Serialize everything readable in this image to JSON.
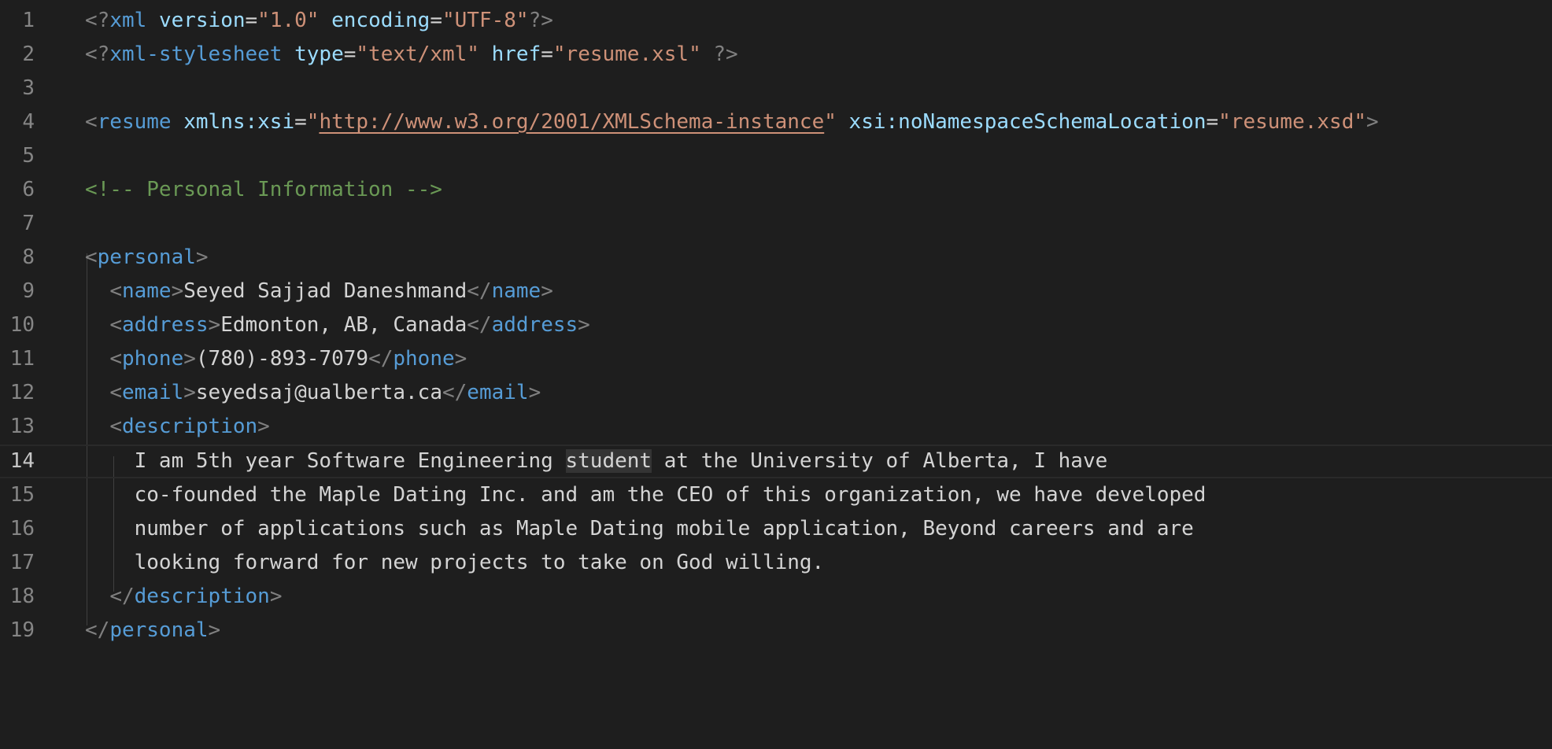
{
  "lines": [
    {
      "num": "1"
    },
    {
      "num": "2"
    },
    {
      "num": "3"
    },
    {
      "num": "4"
    },
    {
      "num": "5"
    },
    {
      "num": "6"
    },
    {
      "num": "7"
    },
    {
      "num": "8"
    },
    {
      "num": "9"
    },
    {
      "num": "10"
    },
    {
      "num": "11"
    },
    {
      "num": "12"
    },
    {
      "num": "13"
    },
    {
      "num": "14"
    },
    {
      "num": "15"
    },
    {
      "num": "16"
    },
    {
      "num": "17"
    },
    {
      "num": "18"
    },
    {
      "num": "19"
    }
  ],
  "xml_decl": {
    "open": "<?",
    "name": "xml",
    "version_attr": "version",
    "version_val": "\"1.0\"",
    "encoding_attr": "encoding",
    "encoding_val": "\"UTF-8\"",
    "close": "?>"
  },
  "stylesheet_pi": {
    "open": "<?",
    "name": "xml-stylesheet",
    "type_attr": "type",
    "type_val": "\"text/xml\"",
    "href_attr": "href",
    "href_val": "\"resume.xsl\"",
    "close": " ?>"
  },
  "resume_tag": {
    "name": "resume",
    "xmlns_attr": "xmlns:xsi",
    "quote": "\"",
    "xmlns_url": "http://www.w3.org/2001/XMLSchema-instance",
    "schema_attr": "xsi:noNamespaceSchemaLocation",
    "schema_val": "\"resume.xsd\""
  },
  "comment": "<!-- Personal Information -->",
  "personal": {
    "tag": "personal",
    "name_tag": "name",
    "name": "Seyed Sajjad Daneshmand",
    "address_tag": "address",
    "address": "Edmonton, AB, Canada",
    "phone_tag": "phone",
    "phone": "(780)-893-7079",
    "email_tag": "email",
    "email": "seyedsaj@ualberta.ca",
    "description_tag": "description",
    "description_lines": [
      "I am 5th year Software Engineering ",
      "student",
      " at the University of Alberta, I have",
      "co-founded the Maple Dating Inc. and am the CEO of this organization, we have developed",
      "number of applications such as Maple Dating mobile application, Beyond careers and are",
      "looking forward for new projects to take on God willing."
    ]
  },
  "colors": {
    "background": "#1e1e1e",
    "line_number": "#858585",
    "tag": "#569cd6",
    "attribute": "#9cdcfe",
    "string": "#ce9178",
    "comment": "#6a9955",
    "punctuation": "#808080",
    "text": "#d4d4d4"
  }
}
